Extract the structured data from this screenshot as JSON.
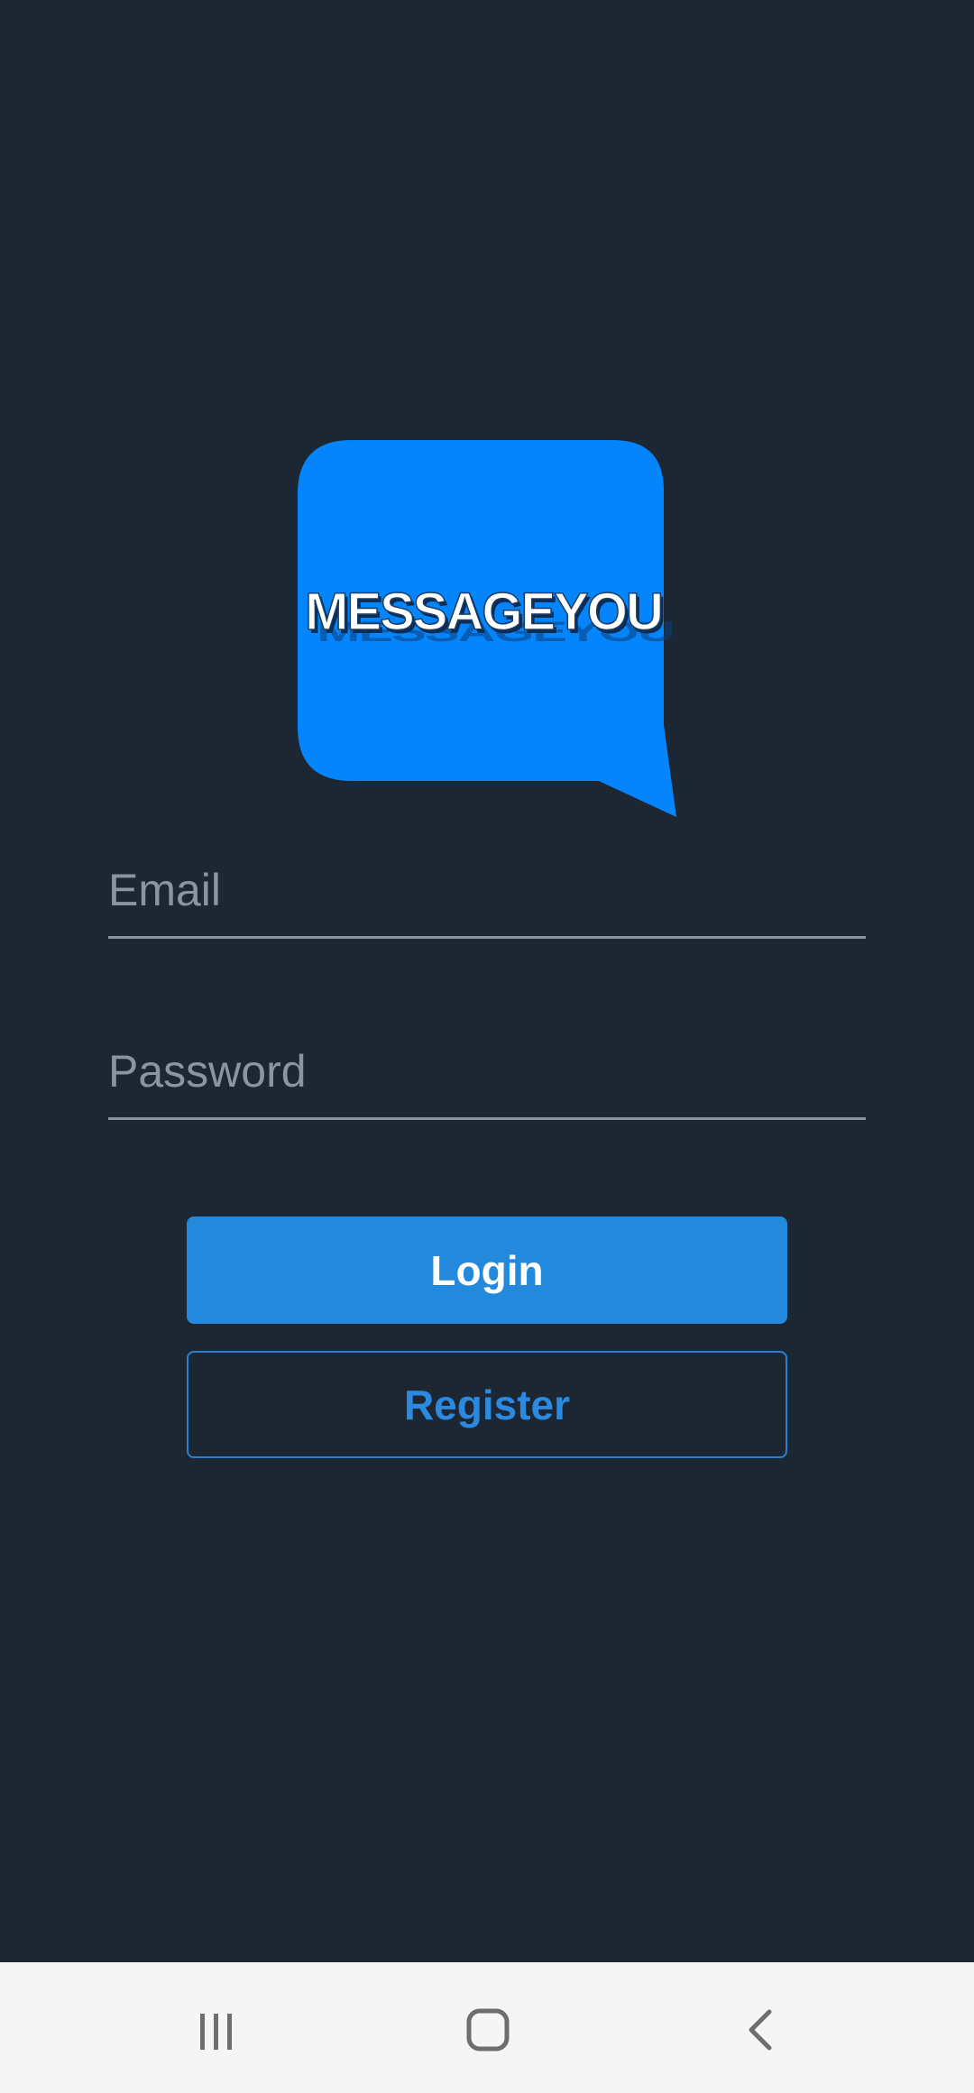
{
  "app": {
    "logo_text": "MESSAGEYOU",
    "logo_color": "#0585fc"
  },
  "form": {
    "email_placeholder": "Email",
    "password_placeholder": "Password",
    "login_label": "Login",
    "register_label": "Register"
  },
  "navbar": {
    "recent_icon": "recent-apps-icon",
    "home_icon": "home-icon",
    "back_icon": "back-icon"
  },
  "colors": {
    "background": "#1d2733",
    "primary": "#2389dd",
    "navbar": "#f5f5f5"
  }
}
